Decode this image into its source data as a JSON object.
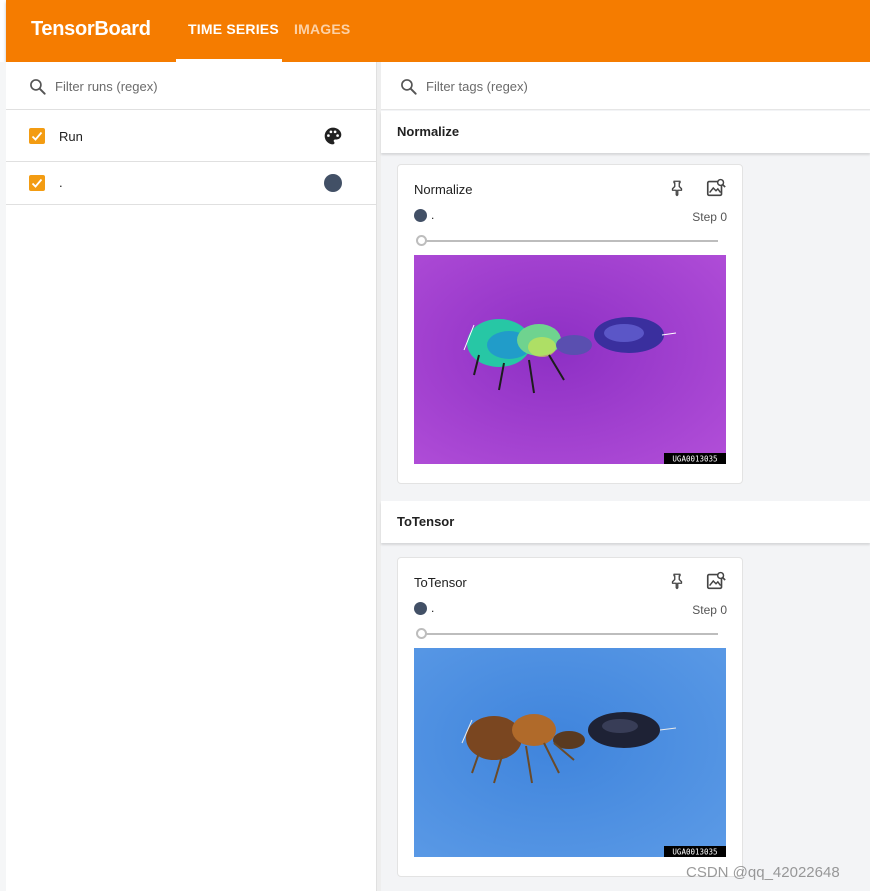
{
  "header": {
    "brand": "TensorBoard",
    "tabs": [
      {
        "label": "TIME SERIES",
        "active": true
      },
      {
        "label": "IMAGES",
        "active": false
      }
    ],
    "color": "#f57c00"
  },
  "runs_panel": {
    "search_placeholder": "Filter runs (regex)",
    "rows": [
      {
        "label": "Run",
        "checked": true,
        "icon": "palette-icon"
      },
      {
        "label": ".",
        "checked": true,
        "color": "#425066"
      }
    ]
  },
  "main": {
    "tag_search_placeholder": "Filter tags (regex)",
    "groups": [
      {
        "title": "Normalize",
        "card": {
          "title": "Normalize",
          "run_label": ".",
          "step_label": "Step 0",
          "image_caption": "UGA0013035",
          "image_background": "#a63fd1"
        }
      },
      {
        "title": "ToTensor",
        "card": {
          "title": "ToTensor",
          "run_label": ".",
          "step_label": "Step 0",
          "image_caption": "UGA0013035",
          "image_background": "#4d90e0"
        }
      }
    ]
  },
  "watermark": "CSDN @qq_42022648",
  "colors": {
    "accent": "#f57c00",
    "checkbox": "#f39c12",
    "run_color": "#425066"
  }
}
